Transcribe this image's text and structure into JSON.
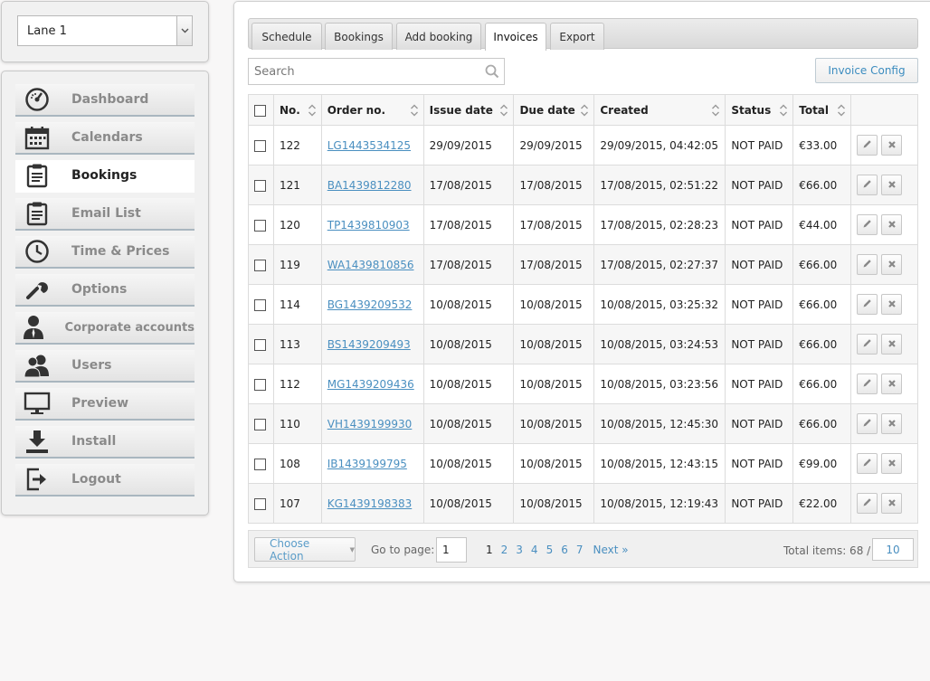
{
  "lane_selector": {
    "value": "Lane 1"
  },
  "nav": {
    "items": [
      {
        "label": "Dashboard",
        "icon": "dashboard-gauge-icon"
      },
      {
        "label": "Calendars",
        "icon": "calendar-icon"
      },
      {
        "label": "Bookings",
        "icon": "clipboard-icon",
        "active": true
      },
      {
        "label": "Email List",
        "icon": "clipboard-icon"
      },
      {
        "label": "Time & Prices",
        "icon": "clock-icon"
      },
      {
        "label": "Options",
        "icon": "wrench-icon"
      },
      {
        "label": "Corporate accounts",
        "icon": "businessman-icon"
      },
      {
        "label": "Users",
        "icon": "users-icon"
      },
      {
        "label": "Preview",
        "icon": "monitor-icon"
      },
      {
        "label": "Install",
        "icon": "download-icon"
      },
      {
        "label": "Logout",
        "icon": "logout-icon"
      }
    ]
  },
  "tabs": [
    {
      "label": "Schedule"
    },
    {
      "label": "Bookings"
    },
    {
      "label": "Add booking"
    },
    {
      "label": "Invoices",
      "active": true
    },
    {
      "label": "Export"
    }
  ],
  "search": {
    "placeholder": "Search",
    "value": ""
  },
  "invoice_config_label": "Invoice Config",
  "table": {
    "columns": [
      "No.",
      "Order no.",
      "Issue date",
      "Due date",
      "Created",
      "Status",
      "Total"
    ],
    "rows": [
      {
        "no": "122",
        "order": "LG1443534125",
        "issue": "29/09/2015",
        "due": "29/09/2015",
        "created": "29/09/2015, 04:42:05",
        "status": "NOT PAID",
        "total": "€33.00"
      },
      {
        "no": "121",
        "order": "BA1439812280",
        "issue": "17/08/2015",
        "due": "17/08/2015",
        "created": "17/08/2015, 02:51:22",
        "status": "NOT PAID",
        "total": "€66.00"
      },
      {
        "no": "120",
        "order": "TP1439810903",
        "issue": "17/08/2015",
        "due": "17/08/2015",
        "created": "17/08/2015, 02:28:23",
        "status": "NOT PAID",
        "total": "€44.00"
      },
      {
        "no": "119",
        "order": "WA1439810856",
        "issue": "17/08/2015",
        "due": "17/08/2015",
        "created": "17/08/2015, 02:27:37",
        "status": "NOT PAID",
        "total": "€66.00"
      },
      {
        "no": "114",
        "order": "BG1439209532",
        "issue": "10/08/2015",
        "due": "10/08/2015",
        "created": "10/08/2015, 03:25:32",
        "status": "NOT PAID",
        "total": "€66.00"
      },
      {
        "no": "113",
        "order": "BS1439209493",
        "issue": "10/08/2015",
        "due": "10/08/2015",
        "created": "10/08/2015, 03:24:53",
        "status": "NOT PAID",
        "total": "€66.00"
      },
      {
        "no": "112",
        "order": "MG1439209436",
        "issue": "10/08/2015",
        "due": "10/08/2015",
        "created": "10/08/2015, 03:23:56",
        "status": "NOT PAID",
        "total": "€66.00"
      },
      {
        "no": "110",
        "order": "VH1439199930",
        "issue": "10/08/2015",
        "due": "10/08/2015",
        "created": "10/08/2015, 12:45:30",
        "status": "NOT PAID",
        "total": "€66.00"
      },
      {
        "no": "108",
        "order": "IB1439199795",
        "issue": "10/08/2015",
        "due": "10/08/2015",
        "created": "10/08/2015, 12:43:15",
        "status": "NOT PAID",
        "total": "€99.00"
      },
      {
        "no": "107",
        "order": "KG1439198383",
        "issue": "10/08/2015",
        "due": "10/08/2015",
        "created": "10/08/2015, 12:19:43",
        "status": "NOT PAID",
        "total": "€22.00"
      }
    ]
  },
  "footer": {
    "choose_action_label": "Choose Action",
    "goto_label": "Go to page:",
    "goto_value": "1",
    "pages": [
      "1",
      "2",
      "3",
      "4",
      "5",
      "6",
      "7"
    ],
    "current_page": "1",
    "next_label": "Next »",
    "total_label": "Total items: 68 /",
    "per_page": "10"
  },
  "colors": {
    "link": "#4a8fc0",
    "active_nav_bg": "#ffffff",
    "nav_border": "#a9b6bf"
  }
}
